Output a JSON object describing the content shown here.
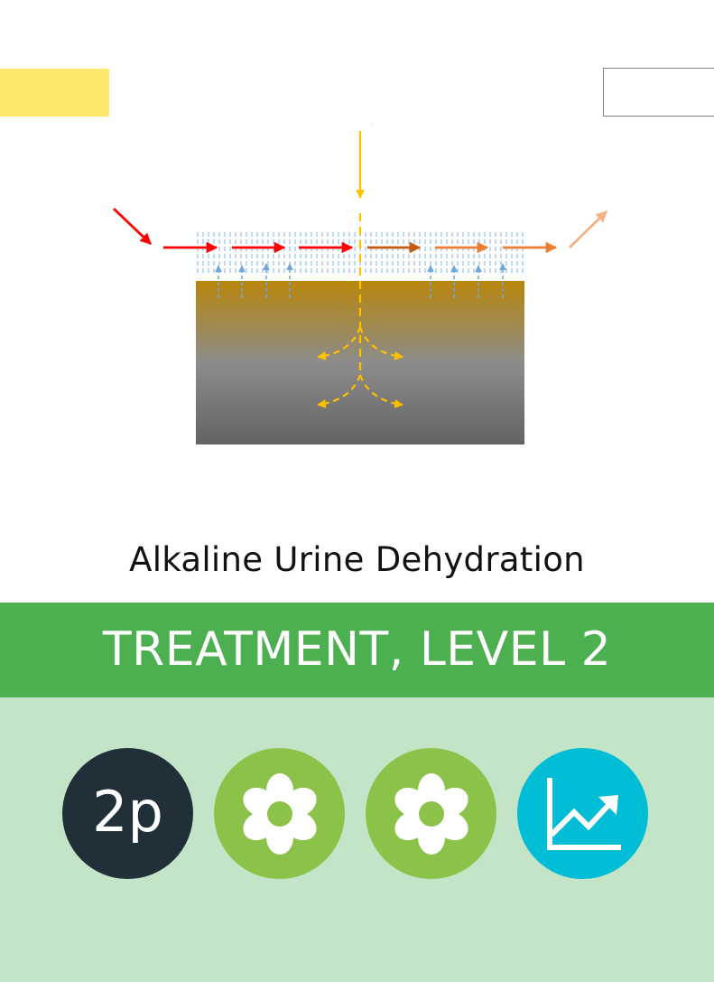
{
  "title": "Alkaline Urine Dehydration",
  "banner": {
    "label": "TREATMENT, LEVEL 2",
    "color": "#4caf50"
  },
  "tags": {
    "left_color": "#ffe66d",
    "right_color": "#ffffff"
  },
  "diagram": {
    "tiny_label": "...",
    "colors": {
      "soil_top": "#b8860b",
      "soil_mid": "#8c8c8c",
      "soil_bottom": "#636363",
      "hatch": "#6fa8dc",
      "evaporation_arrows": "#6fa8dc",
      "urine_arrow": "#ffc000",
      "air_arrows": [
        "#ff0000",
        "#ff0000",
        "#ff0000",
        "#ff0000",
        "#c55a11",
        "#ed7d31",
        "#ed7d31",
        "#f4b183"
      ]
    }
  },
  "badges": [
    {
      "name": "players",
      "text": "2p",
      "color": "#212f38"
    },
    {
      "name": "flower",
      "icon": "flower-icon",
      "color": "#8bc34a"
    },
    {
      "name": "flower",
      "icon": "flower-icon",
      "color": "#8bc34a"
    },
    {
      "name": "chart",
      "icon": "trend-chart-icon",
      "color": "#00bcd4"
    }
  ],
  "bottom_panel_color": "#c3e4c6"
}
